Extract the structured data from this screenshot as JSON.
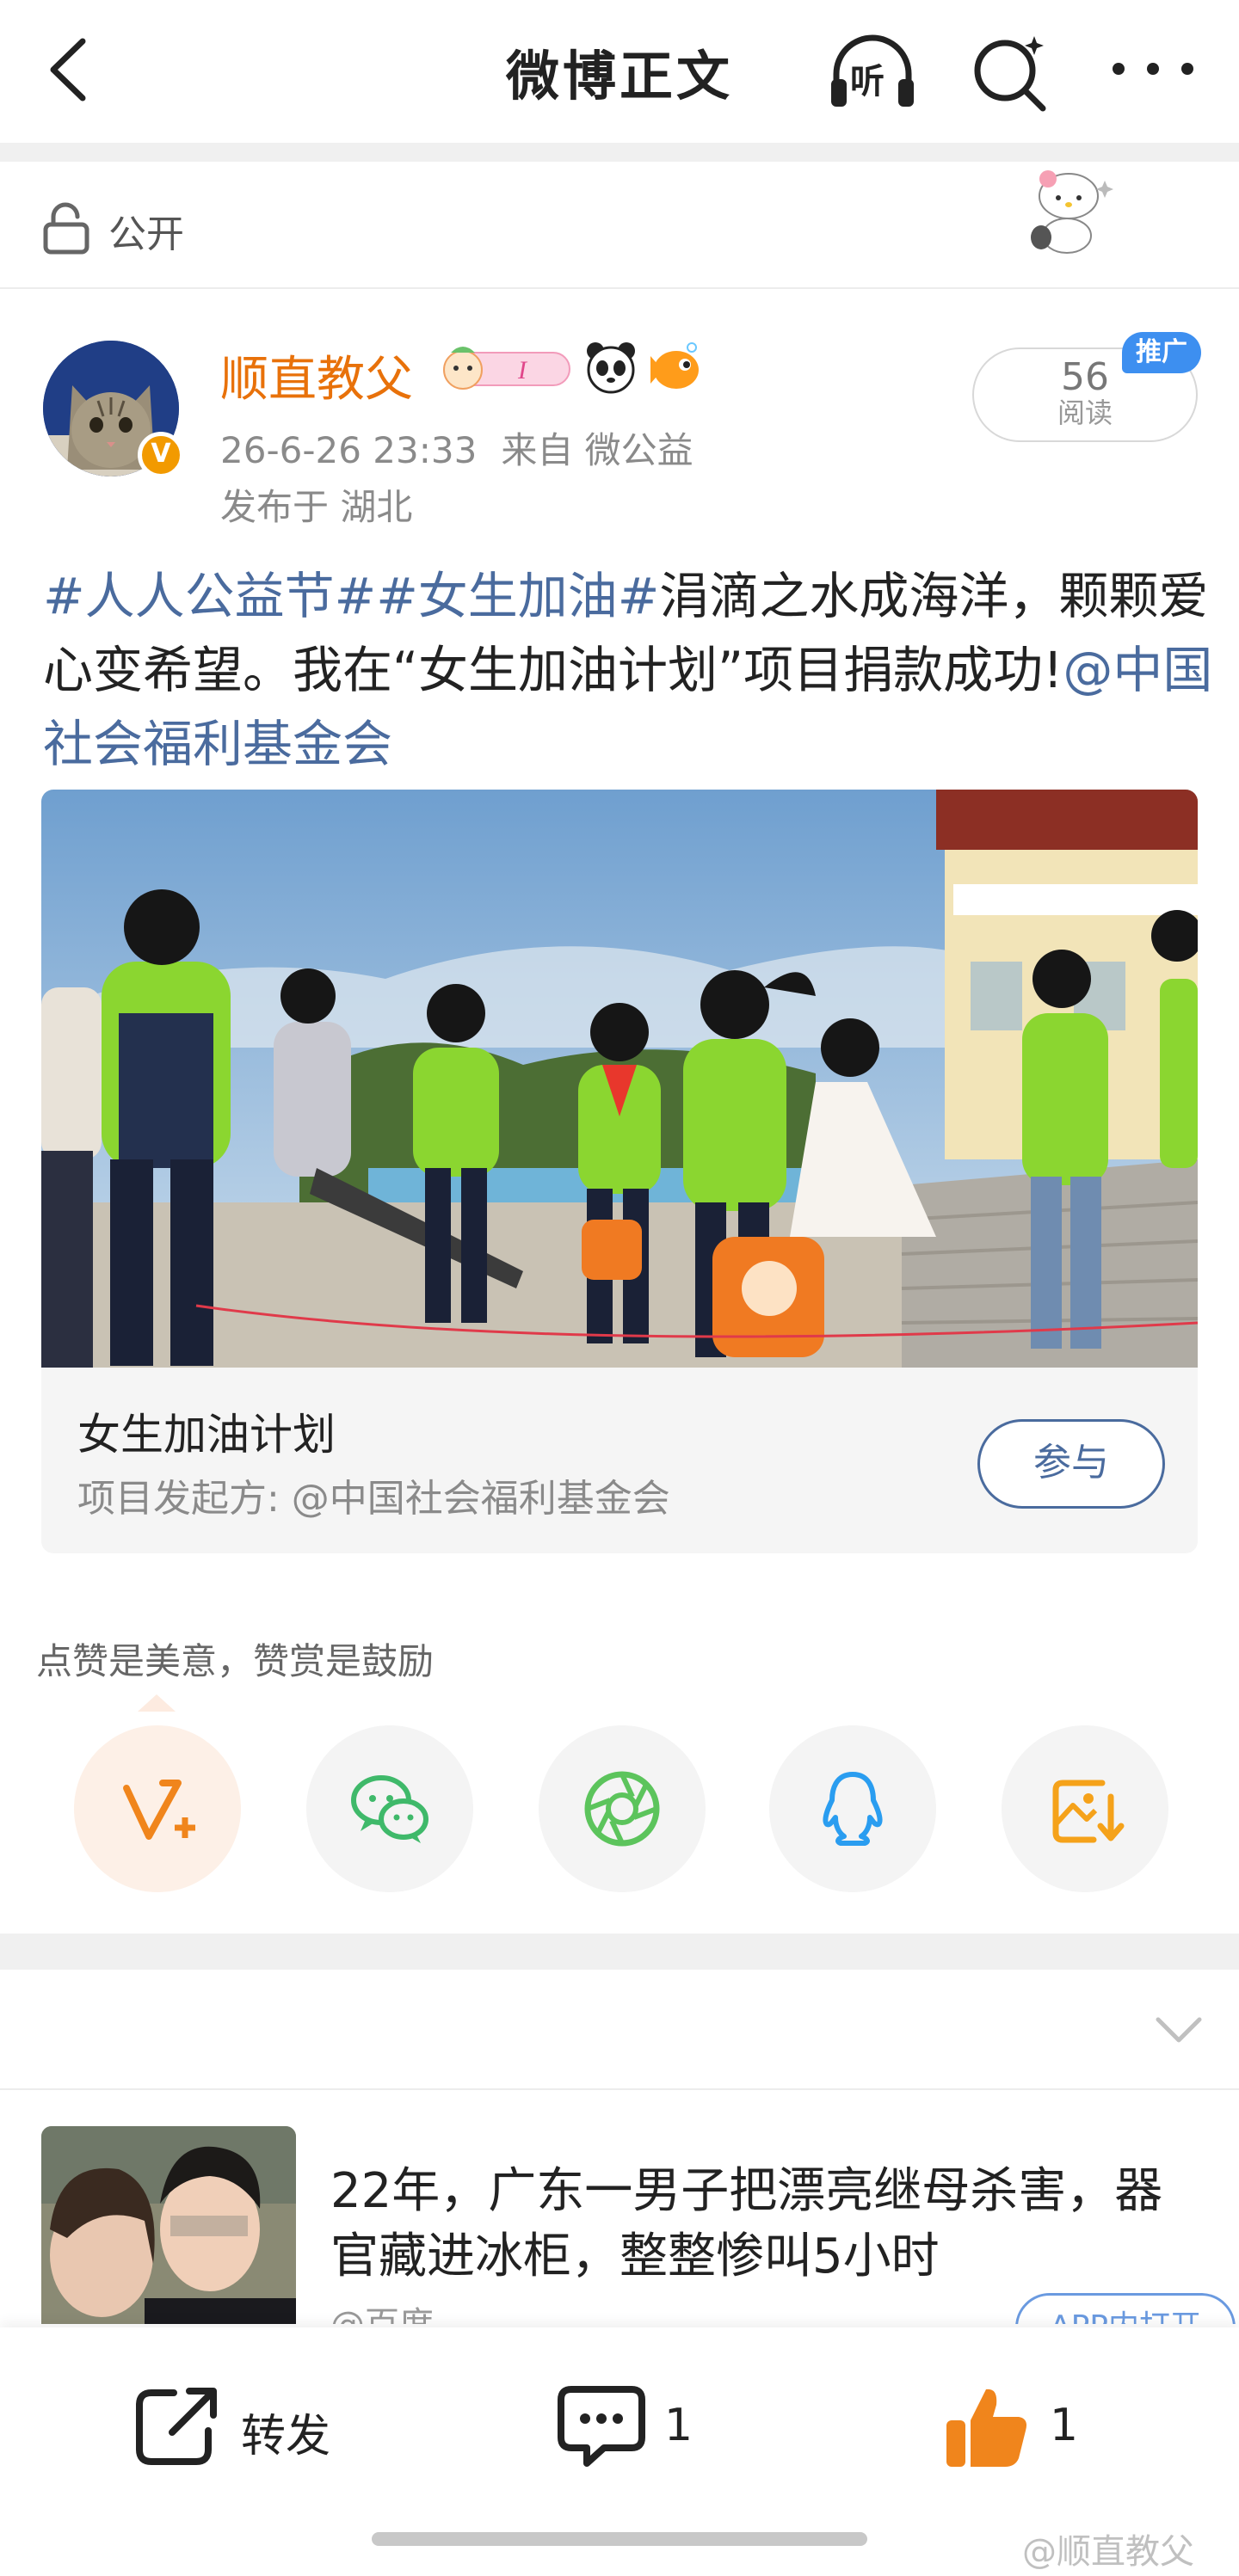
{
  "nav": {
    "title": "微博正文",
    "listen_label": "听"
  },
  "visibility": {
    "label": "公开"
  },
  "author": {
    "name": "顺直教父",
    "badge_text": "I",
    "timestamp": "26-6-26 23:33",
    "source": "来自 微公益",
    "location": "发布于 湖北",
    "read_count": "56",
    "read_label": "阅读",
    "promo_label": "推广"
  },
  "post": {
    "tag1": "#人人公益节#",
    "tag2": "#女生加油#",
    "text1": "涓滴之水成海洋，颗颗爱心变希望。我在“女生加油计划”项目捐款成功!",
    "mention": "@中国社会福利基金会"
  },
  "project_card": {
    "title": "女生加油计划",
    "subtitle": "项目发起方: @中国社会福利基金会",
    "join_label": "参与"
  },
  "share": {
    "prompt": "点赞是美意，赞赏是鼓励",
    "buttons": [
      "reward-icon",
      "wechat-icon",
      "moments-icon",
      "qq-icon",
      "save-image-icon"
    ]
  },
  "ad": {
    "title": "22年，广东一男子把漂亮继母杀害，器官藏进冰柜，整整惨叫5小时",
    "source": "@百度",
    "open_label": "APP内打开"
  },
  "bottom": {
    "repost_label": "转发",
    "comment_count": "1",
    "like_count": "1"
  },
  "watermark": "@顺直教父",
  "colors": {
    "accent_orange": "#e8710a",
    "link_blue": "#4a6b9e",
    "vip_blue": "#3d8ff0"
  }
}
